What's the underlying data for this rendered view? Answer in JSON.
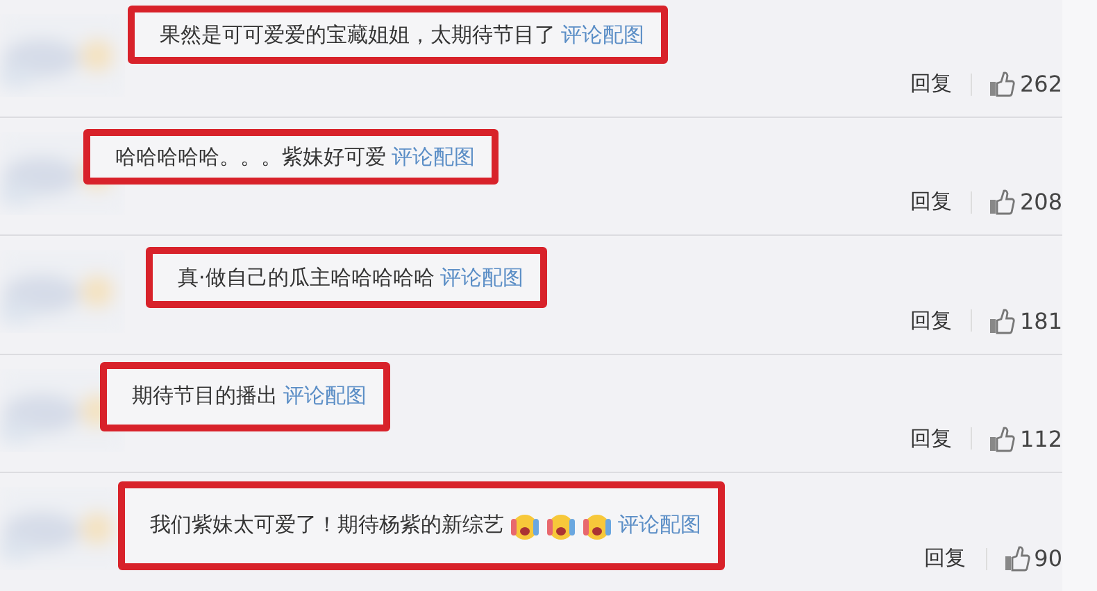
{
  "comments": [
    {
      "text": "果然是可可爱爱的宝藏姐姐，太期待节目了",
      "link": "评论配图",
      "highlighted": true,
      "reply": "回复",
      "likes": "262"
    },
    {
      "text": "哈哈哈哈哈。。。紫妹好可爱",
      "link": "评论配图",
      "highlighted": true,
      "reply": "回复",
      "likes": "208"
    },
    {
      "text": "真·做自己的瓜主哈哈哈哈哈",
      "link": "评论配图",
      "highlighted": true,
      "reply": "回复",
      "likes": "181"
    },
    {
      "text": "期待节目的播出",
      "link": "评论配图",
      "highlighted": true,
      "reply": "回复",
      "likes": "112"
    },
    {
      "text": "我们紫妹太可爱了！期待杨紫的新综艺",
      "emojis": [
        {
          "kind": "tears"
        },
        {
          "kind": "tears"
        },
        {
          "kind": "tears"
        }
      ],
      "link": "评论配图",
      "highlighted": true,
      "reply": "回复",
      "likes": "90"
    }
  ]
}
